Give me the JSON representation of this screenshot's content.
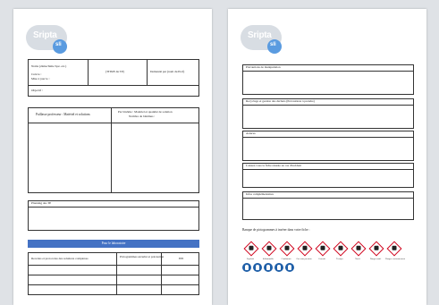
{
  "logo": {
    "text": "Sripta",
    "badge": "sli"
  },
  "left": {
    "header": {
      "names": "Noms (2ème/3ème Spé. etc.)",
      "title": "(TITRE du TP)",
      "requested_by": "Demandé par (nom du Prof)",
      "created": "Créé le :",
      "updated": "Mise à jour le :",
      "objective": "Objectif :"
    },
    "table1": {
      "col1": "Paillasse professeur : Matériel et solutions",
      "col2_line1": "Par binôme : Matériel et quantité de solution",
      "col2_line2": "Nombre de binômes :"
    },
    "planning": "Planning des TP",
    "blue_bar": "Pour le laboratoire",
    "table2": {
      "col1": "Recettes et protocoles des solutions complexes",
      "col2": "Pictogrammes sécurité et précaution",
      "col3": "EPI"
    }
  },
  "right": {
    "sections": [
      "Précautions de manipulation",
      "Recyclage et gestion des déchets (Précautions à prendre)",
      "Astuces",
      "Laissez-vous la fiche réussie en cas d'incident",
      "Infos complémentaires"
    ],
    "picto_title": "Banque de pictogrammes à insérer dans votre fiche :",
    "pictos": [
      "Explosif",
      "Inflammable",
      "Comburant",
      "Gaz sous pression",
      "Corrosif",
      "Toxique",
      "Nocif",
      "Danger santé",
      "Danger environnement"
    ],
    "epi_icons": [
      "blouse-icon",
      "lunettes-icon",
      "gants-icon",
      "masque-icon",
      "chaussures-icon"
    ],
    "colors": {
      "hazard": "#d0021b",
      "epi": "#1f5fa8",
      "bar": "#4472c4"
    }
  }
}
